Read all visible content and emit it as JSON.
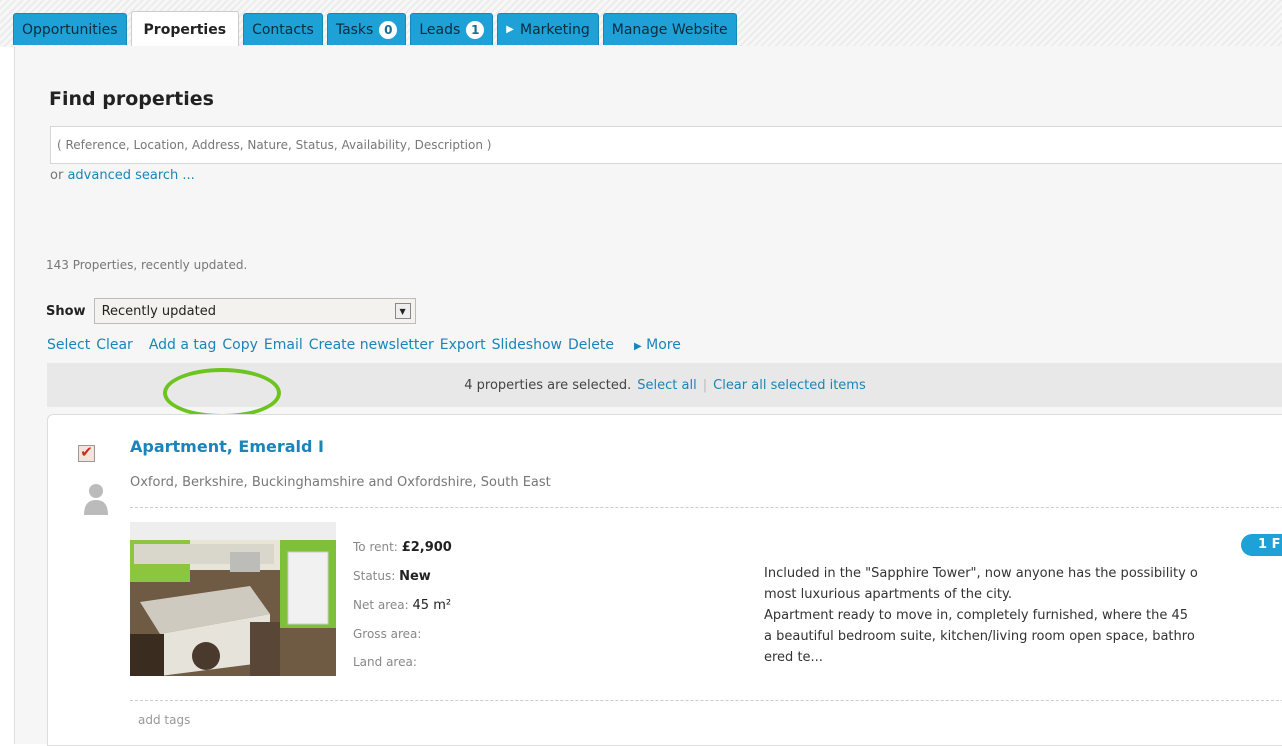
{
  "tabs": [
    {
      "label": "Opportunities"
    },
    {
      "label": "Properties"
    },
    {
      "label": "Contacts"
    },
    {
      "label": "Tasks",
      "badge": "0"
    },
    {
      "label": "Leads",
      "badge": "1"
    },
    {
      "label": "Marketing"
    },
    {
      "label": "Manage Website"
    }
  ],
  "find": {
    "title": "Find properties",
    "placeholder": "( Reference, Location, Address, Nature, Status, Availability, Description )",
    "or_text": "or",
    "advanced_link": "advanced search ..."
  },
  "results": {
    "count_text": "143 Properties, recently updated.",
    "show_label": "Show",
    "show_value": "Recently updated"
  },
  "actions": {
    "select": "Select",
    "clear": "Clear",
    "add_tag": "Add a tag",
    "copy": "Copy",
    "email": "Email",
    "create_newsletter": "Create newsletter",
    "export": "Export",
    "slideshow": "Slideshow",
    "delete": "Delete",
    "more": "More"
  },
  "selection": {
    "text": "4 properties are selected.",
    "select_all": "Select all",
    "divider": "|",
    "clear_all": "Clear all selected items"
  },
  "property": {
    "title": "Apartment, Emerald I",
    "location": "Oxford, Berkshire, Buckinghamshire and Oxfordshire, South East",
    "to_rent_label": "To rent:",
    "to_rent_value": "£2,900",
    "status_label": "Status:",
    "status_value": "New",
    "net_area_label": "Net area:",
    "net_area_value": "45 m²",
    "gross_area_label": "Gross area:",
    "land_area_label": "Land area:",
    "badge": "1 F",
    "description_lines": [
      "Included in the \"Sapphire Tower\", now anyone has the possibility o",
      "most luxurious apartments of the city.",
      "Apartment ready to move in, completely furnished, where the 45",
      "a beautiful bedroom suite, kitchen/living room open space, bathro",
      "ered te..."
    ],
    "add_tags": "add tags"
  },
  "colors": {
    "tab_blue": "#1ea1d6",
    "link_blue": "#1b84b8",
    "highlight_green": "#6cc41f"
  }
}
